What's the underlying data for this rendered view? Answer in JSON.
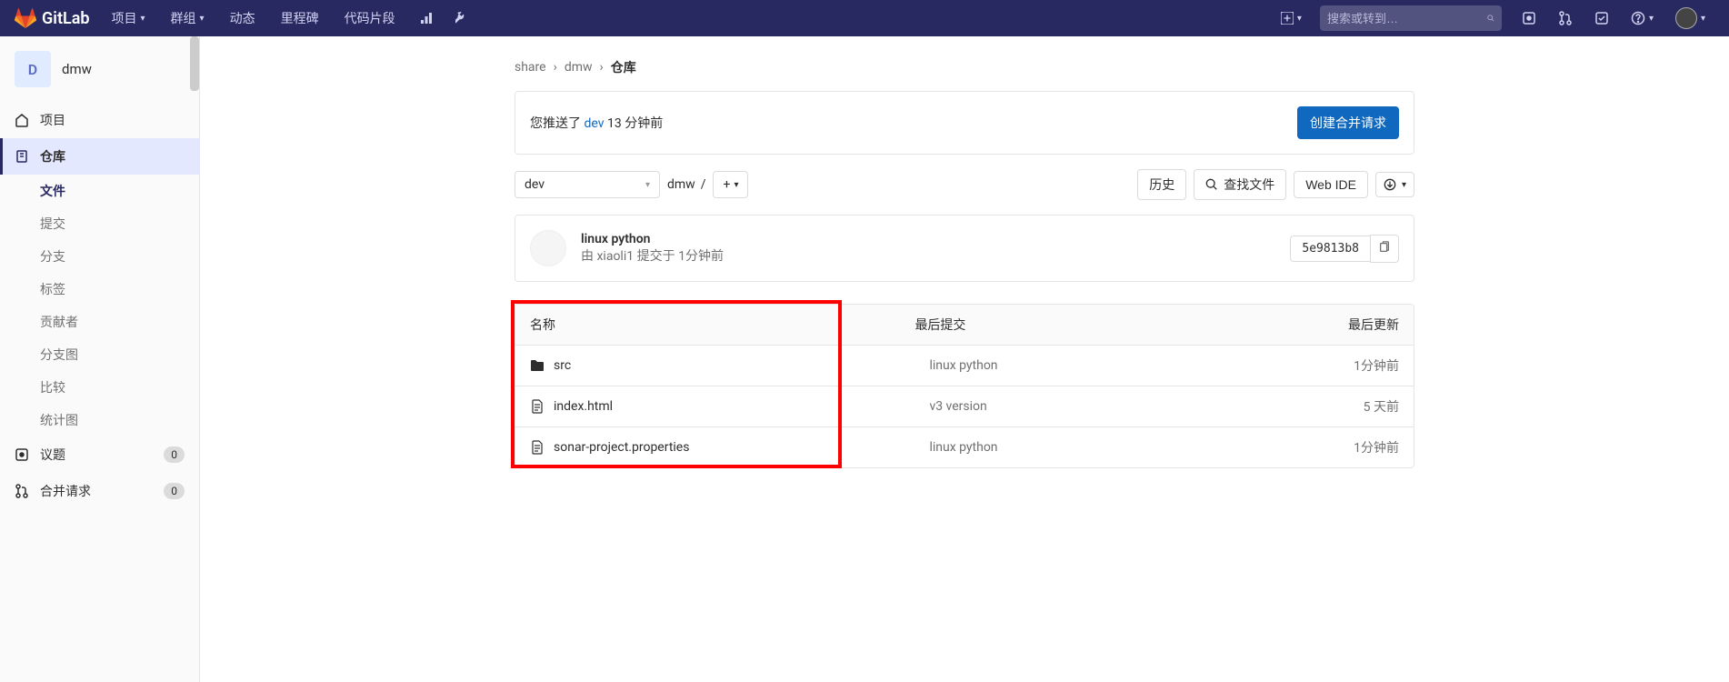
{
  "brand": "GitLab",
  "navbar": {
    "items": [
      "项目",
      "群组",
      "动态",
      "里程碑",
      "代码片段"
    ],
    "search_placeholder": "搜索或转到…"
  },
  "sidebar": {
    "project_initial": "D",
    "project_name": "dmw",
    "items": {
      "project": "项目",
      "repository": "仓库",
      "issues": "议题",
      "issues_count": "0",
      "merge_requests": "合并请求",
      "merge_requests_count": "0"
    },
    "sub_items": [
      "文件",
      "提交",
      "分支",
      "标签",
      "贡献者",
      "分支图",
      "比较",
      "统计图"
    ]
  },
  "breadcrumb": {
    "group": "share",
    "project": "dmw",
    "section": "仓库"
  },
  "push_banner": {
    "prefix": "您推送了",
    "branch": "dev",
    "time": "13 分钟前",
    "create_mr": "创建合并请求"
  },
  "controls": {
    "branch": "dev",
    "path": "dmw",
    "history": "历史",
    "find_file": "查找文件",
    "web_ide": "Web IDE"
  },
  "commit": {
    "title": "linux python",
    "by_prefix": "由",
    "author": "xiaoli1",
    "submitted_at": "提交于",
    "time": "1分钟前",
    "sha": "5e9813b8"
  },
  "table": {
    "headers": {
      "name": "名称",
      "last_commit": "最后提交",
      "last_update": "最后更新"
    },
    "rows": [
      {
        "type": "folder",
        "name": "src",
        "commit": "linux python",
        "updated": "1分钟前"
      },
      {
        "type": "file",
        "name": "index.html",
        "commit": "v3 version",
        "updated": "5 天前"
      },
      {
        "type": "file",
        "name": "sonar-project.properties",
        "commit": "linux python",
        "updated": "1分钟前"
      }
    ]
  }
}
